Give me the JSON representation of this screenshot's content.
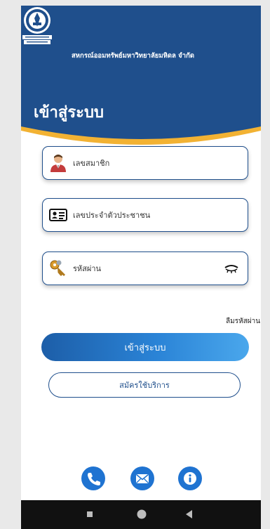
{
  "header": {
    "org_name": "สหกรณ์ออมทรัพย์มหาวิทยาลัยมหิดล จำกัด",
    "page_title": "เข้าสู่ระบบ",
    "logo_icon": "mahidol-seal-logo-icon",
    "colors": {
      "primary": "#1f4f8c",
      "accent": "#f2b233"
    }
  },
  "form": {
    "member_no": {
      "placeholder": "เลขสมาชิก",
      "icon": "user-avatar-icon"
    },
    "citizen_id": {
      "placeholder": "เลขประจำตัวประชาชน",
      "icon": "id-card-icon"
    },
    "password": {
      "placeholder": "รหัสผ่าน",
      "icon": "key-icon",
      "toggle_icon": "eye-closed-icon"
    },
    "forgot_label": "ลืมรหัสผ่าน ?",
    "login_label": "เข้าสู่ระบบ",
    "register_label": "สมัครใช้บริการ"
  },
  "contact": [
    {
      "icon": "phone-icon"
    },
    {
      "icon": "mail-icon"
    },
    {
      "icon": "info-icon"
    }
  ],
  "navbar": [
    {
      "icon": "recent-apps-icon"
    },
    {
      "icon": "home-icon"
    },
    {
      "icon": "back-icon"
    }
  ]
}
